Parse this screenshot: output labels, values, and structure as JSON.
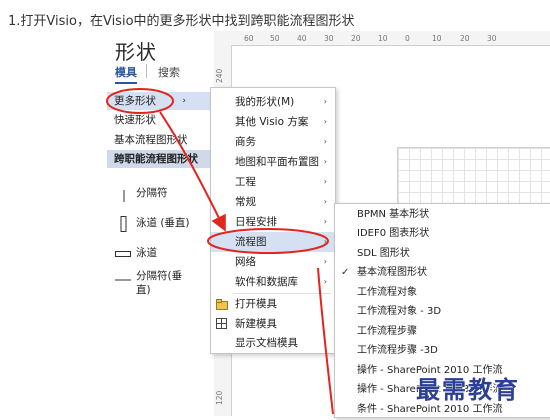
{
  "caption": "1.打开Visio，在Visio中的更多形状中找到跨职能流程图形状",
  "pane": {
    "title": "形状",
    "tab_stencils": "模具",
    "tab_search": "搜索",
    "rows": [
      {
        "label": "更多形状",
        "chevron": "›"
      },
      {
        "label": "快速形状"
      },
      {
        "label": "基本流程图形状"
      },
      {
        "label": "跨职能流程图形状"
      }
    ],
    "shapes": [
      {
        "label": "分隔符"
      },
      {
        "label": "泳道 (垂直)"
      },
      {
        "label": "泳道"
      },
      {
        "label": "分隔符(垂\n直)"
      }
    ]
  },
  "ruler": {
    "top_ticks": [
      "60",
      "50",
      "40",
      "30",
      "20",
      "10",
      "0",
      "10",
      "20",
      "30"
    ],
    "left_ticks": [
      "240",
      "120"
    ]
  },
  "menu1": {
    "items": [
      {
        "label": "我的形状(M)",
        "arrow": "›"
      },
      {
        "label": "其他 Visio 方案",
        "arrow": "›"
      },
      {
        "label": "商务",
        "arrow": "›"
      },
      {
        "label": "地图和平面布置图",
        "arrow": "›"
      },
      {
        "label": "工程",
        "arrow": "›"
      },
      {
        "label": "常规",
        "arrow": "›"
      },
      {
        "label": "日程安排",
        "arrow": "›"
      },
      {
        "label": "流程图",
        "arrow": "›"
      },
      {
        "label": "网络",
        "arrow": "›"
      },
      {
        "label": "软件和数据库",
        "arrow": "›"
      },
      {
        "label": "打开模具",
        "icon": "open-folder-icon"
      },
      {
        "label": "新建模具",
        "icon": "grid-icon"
      },
      {
        "label": "显示文档模具"
      }
    ]
  },
  "menu2": {
    "items": [
      {
        "label": "BPMN 基本形状"
      },
      {
        "label": "IDEF0 图表形状"
      },
      {
        "label": "SDL 图形状"
      },
      {
        "label": "基本流程图形状",
        "checked": "✓"
      },
      {
        "label": "工作流程对象"
      },
      {
        "label": "工作流程对象 - 3D"
      },
      {
        "label": "工作流程步骤"
      },
      {
        "label": "工作流程步骤 -3D"
      },
      {
        "label": "操作 - SharePoint 2010 工作流"
      },
      {
        "label": "操作 - SharePoint 2013 工作流"
      },
      {
        "label": "条件 - SharePoint 2010 工作流"
      }
    ]
  },
  "watermark": "最需教育",
  "colors": {
    "accent": "#2b579a",
    "highlight": "#d5e1f2",
    "annotation": "#e0261f"
  }
}
